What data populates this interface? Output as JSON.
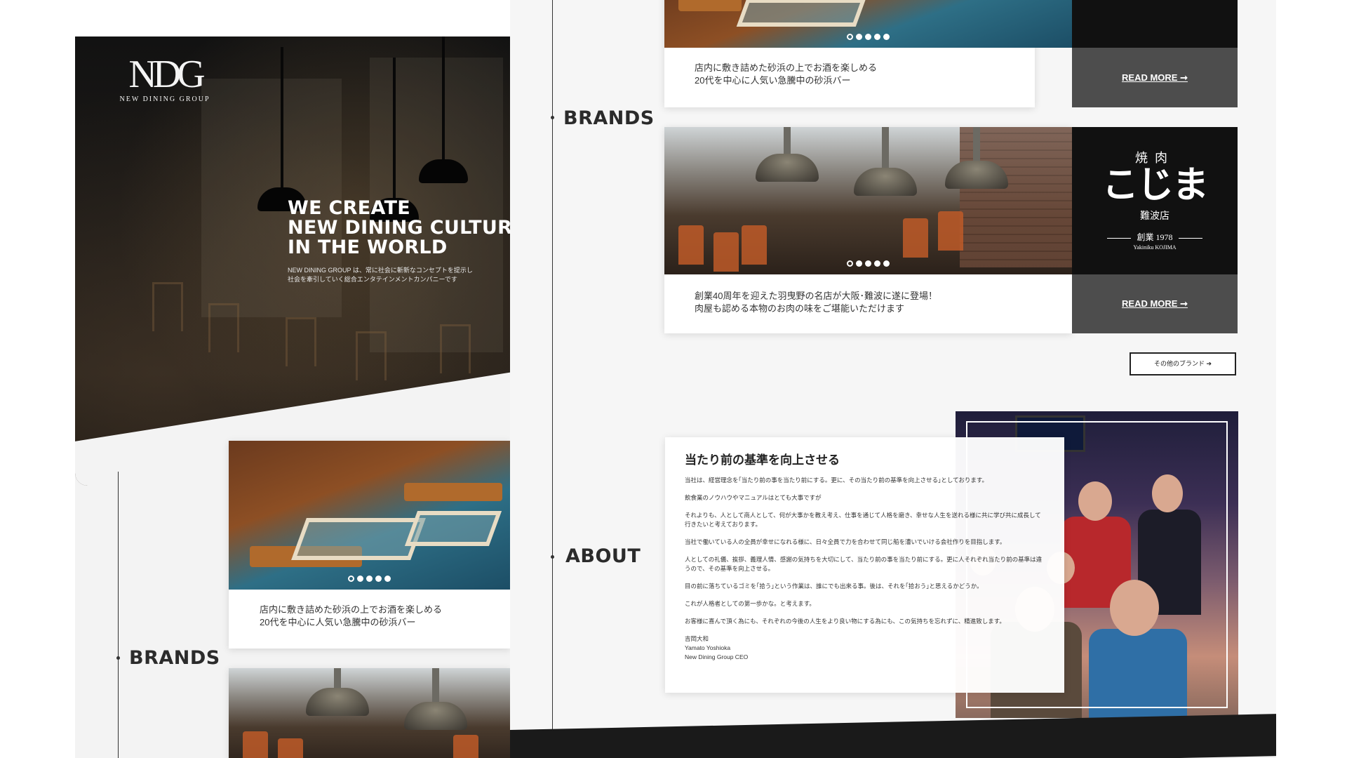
{
  "left": {
    "logo": {
      "mark": "NDG",
      "name": "NEW DINING GROUP"
    },
    "hero": {
      "title_lines": [
        "WE CREATE",
        "NEW DINING CULTURE",
        "IN THE WORLD"
      ],
      "subtitle_lines": [
        "NEW DINING GROUP は、常に社会に斬新なコンセプトを提示し",
        "社会を牽引していく総合エンタテインメントカンパニーです"
      ]
    },
    "card": {
      "text_lines": [
        "店内に敷き詰めた砂浜の上でお酒を楽しめる",
        "20代を中心に人気い急騰中の砂浜バー"
      ]
    },
    "section_label": "BRANDS"
  },
  "right": {
    "brands_label": "BRANDS",
    "card1": {
      "text_lines": [
        "店内に敷き詰めた砂浜の上でお酒を楽しめる",
        "20代を中心に人気い急騰中の砂浜バー"
      ],
      "readmore": "READ MORE ➞"
    },
    "card2": {
      "logo": {
        "line1": "焼肉",
        "line2": "こじま",
        "line3": "難波店",
        "line4": "創業 1978",
        "line5": "Yakiniku KOJIMA"
      },
      "text_lines": [
        "創業40周年を迎えた羽曳野の名店が大阪･難波に遂に登場！",
        "肉屋も認める本物のお肉の味をご堪能いただけます"
      ],
      "readmore": "READ MORE ➞"
    },
    "other_brands_button": "その他のブランド ➔",
    "about_label": "ABOUT",
    "about": {
      "heading": "当たり前の基準を向上させる",
      "paragraphs": [
        "当社は、経営理念を｢当たり前の事を当たり前にする。更に、その当たり前の基準を向上させる｣としております。",
        "飲食業のノウハウやマニュアルはとても大事ですが",
        "それよりも、人として商人として、何が大事かを教え考え、仕事を通じて人格を磨き、幸せな人生を送れる様に共に学び共に成長して行きたいと考えております。",
        "当社で働いている人の全員が幸せになれる様に、日々全員で力を合わせて同じ船を漕いでいける会社作りを目指します。",
        "人としての礼儀、挨拶、義理人情、感謝の気持ちを大切にして、当たり前の事を当たり前にする。更に人それぞれ当たり前の基準は違うので、その基準を向上させる。",
        "目の前に落ちているゴミを｢拾う｣という作業は、誰にでも出来る事。後は、それを｢拾おう｣と思えるかどうか。",
        "これが人格者としての第一歩かな。と考えます。",
        "お客様に喜んで頂く為にも、それぞれの今後の人生をより良い物にする為にも、この気持ちを忘れずに、精進致します。"
      ],
      "signature": [
        "吉岡大和",
        "Yamato Yoshioka",
        "New Dining Group CEO"
      ]
    }
  }
}
